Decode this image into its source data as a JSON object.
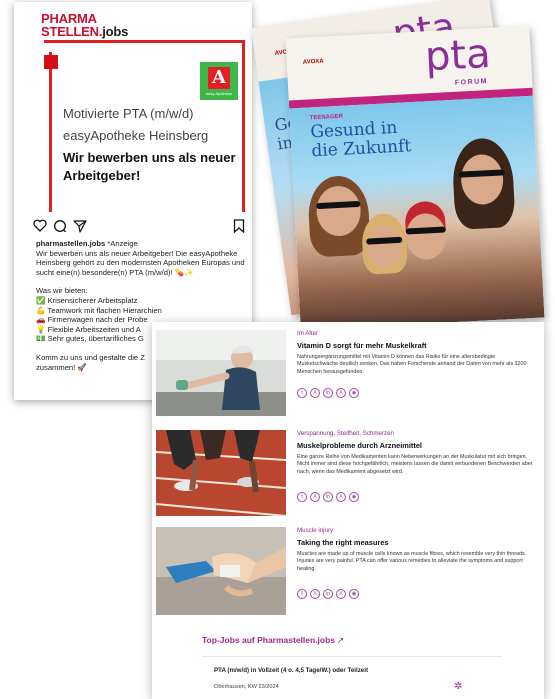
{
  "instagram_post": {
    "brand_line1": "PHARMA",
    "brand_line2": "STELLEN.",
    "brand_line2b": "jobs",
    "pharmacy_logo_text": "easy Apotheke",
    "headline1": "Motivierte PTA (m/w/d)",
    "headline2": "easyApotheke Heinsberg",
    "headline3": "Wir bewerben uns als neuer Arbeitgeber!",
    "icons": [
      "heart-icon",
      "comment-icon",
      "share-icon",
      "bookmark-icon"
    ],
    "caption_user": "pharmastellen.jobs",
    "caption_tag": " *Anzeige",
    "caption_text": "Wir bewerben uns  als neuer Arbeitgeber! Die easyApotheke Heinsberg gehört zu den modernsten Apotheken Europas und sucht eine(n) besondere(n) PTA (m/w/d)! 💊✨",
    "offer_heading": "Was wir bieten:",
    "offers": [
      "✅ Krisensicherer Arbeitsplatz",
      "💪 Teamwork mit flachen Hierarchien",
      "🚗 Firmenwagen nach der Probe",
      "💡 Flexible Arbeitszeiten und A",
      "💵 Sehr gutes, übertarifliches G"
    ],
    "closing": "Komm zu uns und gestalte die Z\nzusammen! 🚀"
  },
  "magazine": {
    "brand_back": "pta",
    "brand_front": "pta",
    "forum": "FORUM",
    "publisher_back": "AVOXA",
    "publisher_front": "AVOXA",
    "kicker": "TEENAGER",
    "headline_back": "Ge\nin d",
    "headline_front": "Gesund in\ndie Zukunft"
  },
  "articles": [
    {
      "kicker": "Im Alter",
      "title": "Vitamin D sorgt für mehr Muskelkraft",
      "body": "Nahrungsergänzungsmittel mit Vitamin D können das Risiko für eine altersbedingte Muskelschwäche deutlich senken. Das haben Forschende anhand der Daten von mehr als 3200 Menschen herausgefunden."
    },
    {
      "kicker": "Verspannung, Steifheit, Schmerzen",
      "title": "Muskelprobleme durch Arzneimittel",
      "body": "Eine ganze Reihe von Medikamenten kann Nebenwirkungen an der Muskulatur mit sich bringen. Nicht immer sind diese hochgefährlich, meistens lassen die damit verbundenen Beschwerden aber nach, wenn das Medikament abgesetzt wird."
    },
    {
      "kicker": "Muscle injury",
      "title": "Taking the right measures",
      "body": "Muscles are made up of muscle cells known as muscle fibres, which resemble very thin threads. Injuries are very painful. PTA can offer various remedies to alleviate the symptoms and support healing."
    }
  ],
  "social_icons": [
    "f",
    "X",
    "in",
    "X",
    "◉"
  ],
  "top_jobs": {
    "heading": "Top-Jobs auf Pharmastellen.jobs",
    "arrow": "↗",
    "job_title": "PTA (m/w/d) in Vollzeit (4 o. 4,5 Tage/W.) oder Teilzeit",
    "job_meta": "Oberhausen, KW 23/2024"
  },
  "colors": {
    "brand_red": "#c8102e",
    "pta_purple": "#8a2f9a",
    "accent_magenta": "#9b2a8c"
  }
}
